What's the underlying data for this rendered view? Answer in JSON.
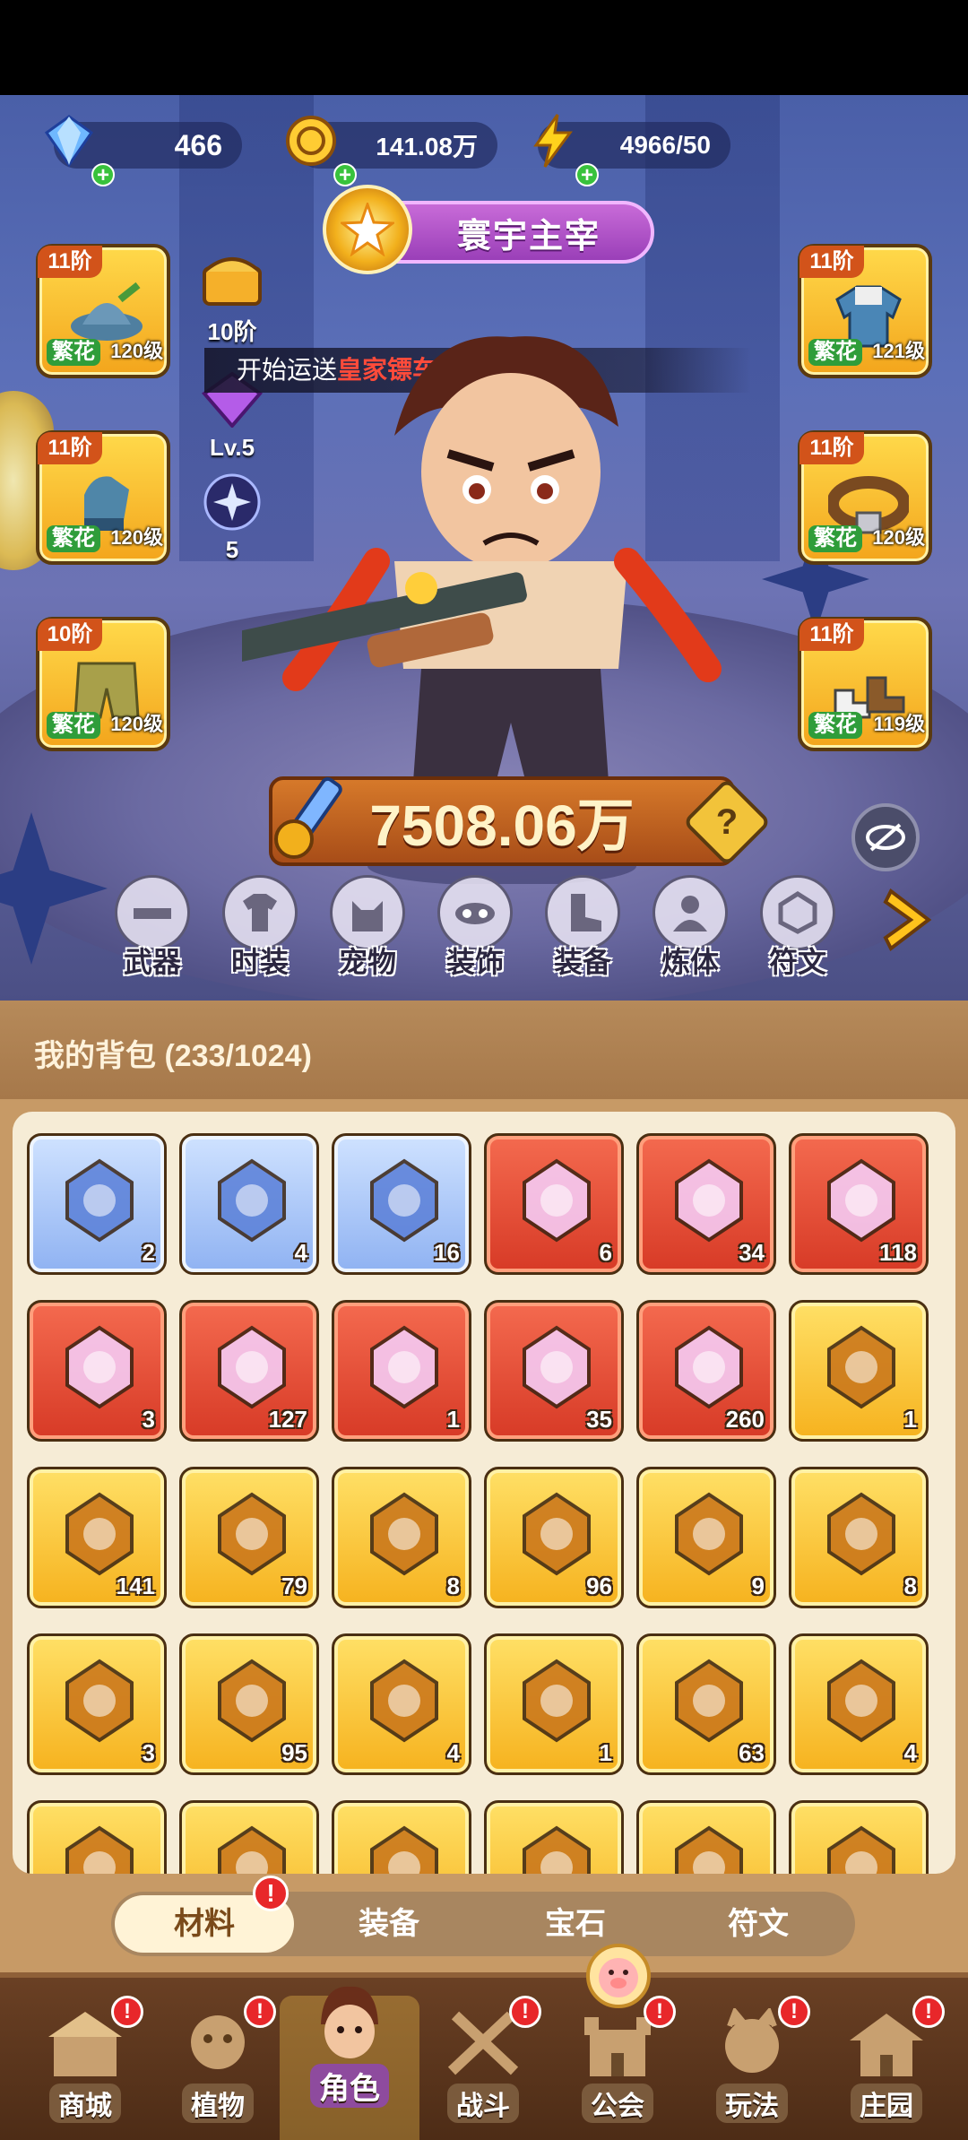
{
  "currency": {
    "diamonds": "466",
    "gold": "141.08万",
    "energy": "4966/50"
  },
  "title_banner": "寰宇主宰",
  "notice": {
    "prefix": "开始运送",
    "highlight": "皇家镖车"
  },
  "mini_items": [
    {
      "name": "chest",
      "label": "10阶"
    },
    {
      "name": "gem",
      "label": "Lv.5"
    },
    {
      "name": "orb",
      "label": "5"
    }
  ],
  "equipment": {
    "left": [
      {
        "tier": "11阶",
        "grade": "繁花",
        "level": "120级",
        "icon": "hat-icon"
      },
      {
        "tier": "11阶",
        "grade": "繁花",
        "level": "120级",
        "icon": "glove-icon"
      },
      {
        "tier": "10阶",
        "grade": "繁花",
        "level": "120级",
        "icon": "pants-icon"
      }
    ],
    "right": [
      {
        "tier": "11阶",
        "grade": "繁花",
        "level": "121级",
        "icon": "coat-icon"
      },
      {
        "tier": "11阶",
        "grade": "繁花",
        "level": "120级",
        "icon": "belt-icon"
      },
      {
        "tier": "11阶",
        "grade": "繁花",
        "level": "119级",
        "icon": "boots-icon"
      }
    ]
  },
  "power": "7508.06万",
  "feature_tabs": [
    "武器",
    "时装",
    "宠物",
    "装饰",
    "装备",
    "炼体",
    "符文"
  ],
  "backpack": {
    "title": "我的背包 (233/1024)",
    "items": [
      {
        "rarity": "blue",
        "icon": "potion-syringe-icon",
        "count": "2"
      },
      {
        "rarity": "blue",
        "icon": "potion-syringe-cloud-icon",
        "count": "4"
      },
      {
        "rarity": "blue",
        "icon": "golden-ring-icon",
        "count": "16"
      },
      {
        "rarity": "red",
        "icon": "blue-star-crystal-icon",
        "count": "6"
      },
      {
        "rarity": "red",
        "icon": "moon-crystal-icon",
        "count": "34"
      },
      {
        "rarity": "red",
        "icon": "red-potion-icon",
        "count": "118"
      },
      {
        "rarity": "red",
        "icon": "green-capsule-icon",
        "count": "3"
      },
      {
        "rarity": "red",
        "icon": "star-prism-icon",
        "count": "127"
      },
      {
        "rarity": "red",
        "icon": "scissors-icon",
        "count": "1"
      },
      {
        "rarity": "red",
        "icon": "knot-rune-icon",
        "count": "35"
      },
      {
        "rarity": "red",
        "icon": "purple-cube-icon",
        "count": "260"
      },
      {
        "rarity": "gold",
        "icon": "water-drop-icon",
        "count": "1"
      },
      {
        "rarity": "gold",
        "icon": "skull-banner-icon",
        "count": "141"
      },
      {
        "rarity": "gold",
        "icon": "magic-hat-icon",
        "count": "79"
      },
      {
        "rarity": "gold",
        "icon": "ankh-icon",
        "count": "8"
      },
      {
        "rarity": "gold",
        "icon": "gold-cloud-icon",
        "count": "96"
      },
      {
        "rarity": "gold",
        "icon": "ruby-key-icon",
        "count": "9"
      },
      {
        "rarity": "gold",
        "icon": "gold-key-icon",
        "count": "8"
      },
      {
        "rarity": "gold",
        "icon": "teal-key-icon",
        "count": "3"
      },
      {
        "rarity": "gold",
        "icon": "fire-prism-icon",
        "count": "95"
      },
      {
        "rarity": "gold",
        "icon": "purple-emblem-icon",
        "count": "4"
      },
      {
        "rarity": "gold",
        "icon": "blue-mushroom-icon",
        "count": "1"
      },
      {
        "rarity": "gold",
        "icon": "spell-book-icon",
        "count": "63"
      },
      {
        "rarity": "gold",
        "icon": "leaf-fruit-icon",
        "count": "4"
      },
      {
        "rarity": "gold",
        "icon": "berries-icon",
        "count": ""
      },
      {
        "rarity": "gold",
        "icon": "pear-icon",
        "count": ""
      },
      {
        "rarity": "gold",
        "icon": "blue-flower-icon",
        "count": ""
      },
      {
        "rarity": "gold",
        "icon": "purple-flower-icon",
        "count": ""
      },
      {
        "rarity": "gold",
        "icon": "dark-rune-icon",
        "count": ""
      },
      {
        "rarity": "gold",
        "icon": "bag-icon",
        "count": ""
      }
    ],
    "filters": [
      "材料",
      "装备",
      "宝石",
      "符文"
    ],
    "filter_badge": "!"
  },
  "bottom_nav": [
    {
      "label": "商城",
      "badge": "!"
    },
    {
      "label": "植物",
      "badge": "!"
    },
    {
      "label": "角色",
      "badge": ""
    },
    {
      "label": "战斗",
      "badge": "!"
    },
    {
      "label": "公会",
      "badge": "!"
    },
    {
      "label": "玩法",
      "badge": "!"
    },
    {
      "label": "庄园",
      "badge": "!"
    }
  ],
  "colors": {
    "accent_gold": "#f6b21e",
    "rarity_red": "#d73a26",
    "rarity_blue": "#8fb2f2",
    "panel_brown": "#c79a66",
    "highlight_red": "#ff4b3a"
  }
}
